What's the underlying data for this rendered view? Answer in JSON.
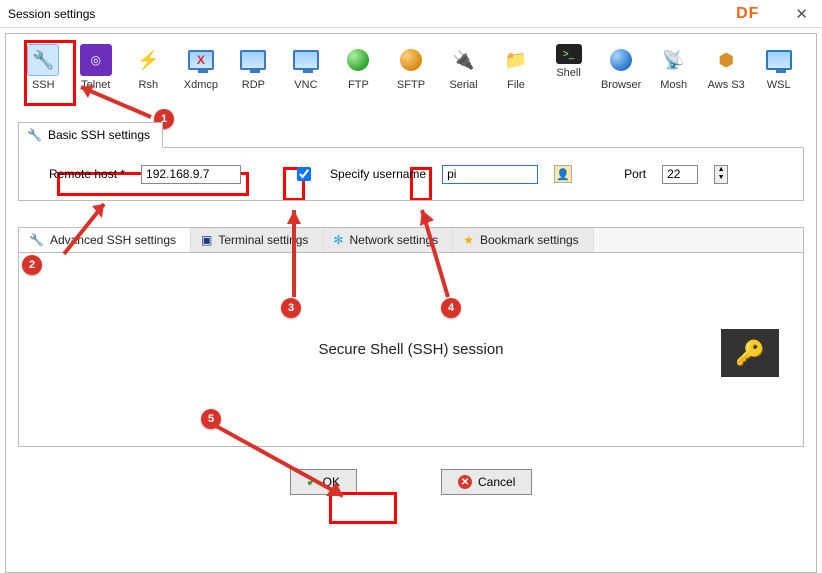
{
  "title": "Session settings",
  "watermark": "DF",
  "types": {
    "ssh": "SSH",
    "telnet": "Telnet",
    "rsh": "Rsh",
    "xdmcp": "Xdmcp",
    "rdp": "RDP",
    "vnc": "VNC",
    "ftp": "FTP",
    "sftp": "SFTP",
    "serial": "Serial",
    "file": "File",
    "shell": "Shell",
    "browser": "Browser",
    "mosh": "Mosh",
    "awsS3": "Aws S3",
    "wsl": "WSL"
  },
  "basic": {
    "tab_label": "Basic SSH settings",
    "remote_host_label": "Remote host *",
    "remote_host_value": "192.168.9.7",
    "specify_username_label": "Specify username",
    "specify_username_checked": true,
    "username_value": "pi",
    "port_label": "Port",
    "port_value": "22"
  },
  "subtabs": {
    "adv": "Advanced SSH settings",
    "term": "Terminal settings",
    "net": "Network settings",
    "book": "Bookmark settings"
  },
  "session_title": "Secure Shell (SSH) session",
  "buttons": {
    "ok": "OK",
    "cancel": "Cancel"
  },
  "badges": {
    "b1": "1",
    "b2": "2",
    "b3": "3",
    "b4": "4",
    "b5": "5"
  }
}
